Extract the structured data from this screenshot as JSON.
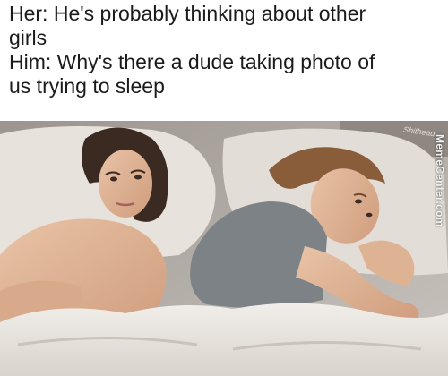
{
  "caption": {
    "lines": [
      "Her: He's probably thinking about other",
      "girls",
      "Him: Why's there a dude taking photo of",
      "us trying to sleep"
    ]
  },
  "watermark": {
    "side_text": "MemeCenter.com",
    "corner_text": "Shithead"
  }
}
